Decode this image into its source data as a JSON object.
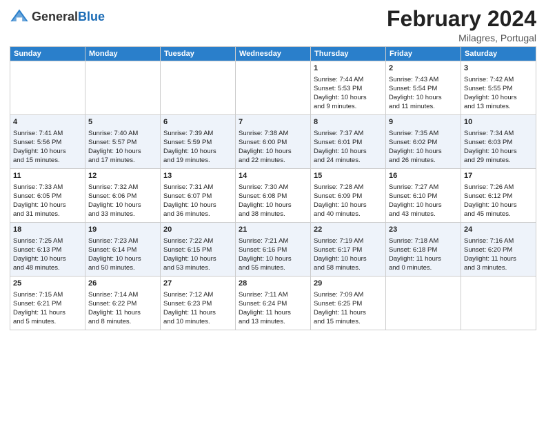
{
  "header": {
    "logo_general": "General",
    "logo_blue": "Blue",
    "month": "February 2024",
    "location": "Milagres, Portugal"
  },
  "columns": [
    "Sunday",
    "Monday",
    "Tuesday",
    "Wednesday",
    "Thursday",
    "Friday",
    "Saturday"
  ],
  "weeks": [
    [
      {
        "day": "",
        "content": ""
      },
      {
        "day": "",
        "content": ""
      },
      {
        "day": "",
        "content": ""
      },
      {
        "day": "",
        "content": ""
      },
      {
        "day": "1",
        "content": "Sunrise: 7:44 AM\nSunset: 5:53 PM\nDaylight: 10 hours\nand 9 minutes."
      },
      {
        "day": "2",
        "content": "Sunrise: 7:43 AM\nSunset: 5:54 PM\nDaylight: 10 hours\nand 11 minutes."
      },
      {
        "day": "3",
        "content": "Sunrise: 7:42 AM\nSunset: 5:55 PM\nDaylight: 10 hours\nand 13 minutes."
      }
    ],
    [
      {
        "day": "4",
        "content": "Sunrise: 7:41 AM\nSunset: 5:56 PM\nDaylight: 10 hours\nand 15 minutes."
      },
      {
        "day": "5",
        "content": "Sunrise: 7:40 AM\nSunset: 5:57 PM\nDaylight: 10 hours\nand 17 minutes."
      },
      {
        "day": "6",
        "content": "Sunrise: 7:39 AM\nSunset: 5:59 PM\nDaylight: 10 hours\nand 19 minutes."
      },
      {
        "day": "7",
        "content": "Sunrise: 7:38 AM\nSunset: 6:00 PM\nDaylight: 10 hours\nand 22 minutes."
      },
      {
        "day": "8",
        "content": "Sunrise: 7:37 AM\nSunset: 6:01 PM\nDaylight: 10 hours\nand 24 minutes."
      },
      {
        "day": "9",
        "content": "Sunrise: 7:35 AM\nSunset: 6:02 PM\nDaylight: 10 hours\nand 26 minutes."
      },
      {
        "day": "10",
        "content": "Sunrise: 7:34 AM\nSunset: 6:03 PM\nDaylight: 10 hours\nand 29 minutes."
      }
    ],
    [
      {
        "day": "11",
        "content": "Sunrise: 7:33 AM\nSunset: 6:05 PM\nDaylight: 10 hours\nand 31 minutes."
      },
      {
        "day": "12",
        "content": "Sunrise: 7:32 AM\nSunset: 6:06 PM\nDaylight: 10 hours\nand 33 minutes."
      },
      {
        "day": "13",
        "content": "Sunrise: 7:31 AM\nSunset: 6:07 PM\nDaylight: 10 hours\nand 36 minutes."
      },
      {
        "day": "14",
        "content": "Sunrise: 7:30 AM\nSunset: 6:08 PM\nDaylight: 10 hours\nand 38 minutes."
      },
      {
        "day": "15",
        "content": "Sunrise: 7:28 AM\nSunset: 6:09 PM\nDaylight: 10 hours\nand 40 minutes."
      },
      {
        "day": "16",
        "content": "Sunrise: 7:27 AM\nSunset: 6:10 PM\nDaylight: 10 hours\nand 43 minutes."
      },
      {
        "day": "17",
        "content": "Sunrise: 7:26 AM\nSunset: 6:12 PM\nDaylight: 10 hours\nand 45 minutes."
      }
    ],
    [
      {
        "day": "18",
        "content": "Sunrise: 7:25 AM\nSunset: 6:13 PM\nDaylight: 10 hours\nand 48 minutes."
      },
      {
        "day": "19",
        "content": "Sunrise: 7:23 AM\nSunset: 6:14 PM\nDaylight: 10 hours\nand 50 minutes."
      },
      {
        "day": "20",
        "content": "Sunrise: 7:22 AM\nSunset: 6:15 PM\nDaylight: 10 hours\nand 53 minutes."
      },
      {
        "day": "21",
        "content": "Sunrise: 7:21 AM\nSunset: 6:16 PM\nDaylight: 10 hours\nand 55 minutes."
      },
      {
        "day": "22",
        "content": "Sunrise: 7:19 AM\nSunset: 6:17 PM\nDaylight: 10 hours\nand 58 minutes."
      },
      {
        "day": "23",
        "content": "Sunrise: 7:18 AM\nSunset: 6:18 PM\nDaylight: 11 hours\nand 0 minutes."
      },
      {
        "day": "24",
        "content": "Sunrise: 7:16 AM\nSunset: 6:20 PM\nDaylight: 11 hours\nand 3 minutes."
      }
    ],
    [
      {
        "day": "25",
        "content": "Sunrise: 7:15 AM\nSunset: 6:21 PM\nDaylight: 11 hours\nand 5 minutes."
      },
      {
        "day": "26",
        "content": "Sunrise: 7:14 AM\nSunset: 6:22 PM\nDaylight: 11 hours\nand 8 minutes."
      },
      {
        "day": "27",
        "content": "Sunrise: 7:12 AM\nSunset: 6:23 PM\nDaylight: 11 hours\nand 10 minutes."
      },
      {
        "day": "28",
        "content": "Sunrise: 7:11 AM\nSunset: 6:24 PM\nDaylight: 11 hours\nand 13 minutes."
      },
      {
        "day": "29",
        "content": "Sunrise: 7:09 AM\nSunset: 6:25 PM\nDaylight: 11 hours\nand 15 minutes."
      },
      {
        "day": "",
        "content": ""
      },
      {
        "day": "",
        "content": ""
      }
    ]
  ]
}
